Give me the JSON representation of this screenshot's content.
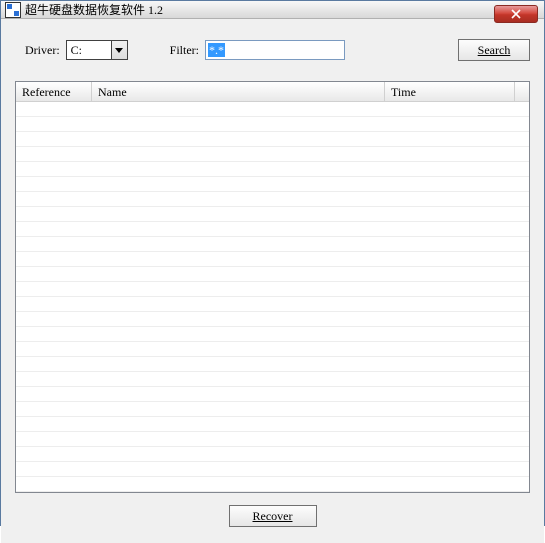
{
  "window": {
    "title": "超牛硬盘数据恢复软件 1.2"
  },
  "controls": {
    "driver_label": "Driver:",
    "driver_value": "C:",
    "filter_label": "Filter:",
    "filter_value": "*.*",
    "search_label": "Search"
  },
  "table": {
    "columns": {
      "reference": "Reference",
      "name": "Name",
      "time": "Time"
    },
    "rows": []
  },
  "footer": {
    "recover_label": "Recover"
  }
}
